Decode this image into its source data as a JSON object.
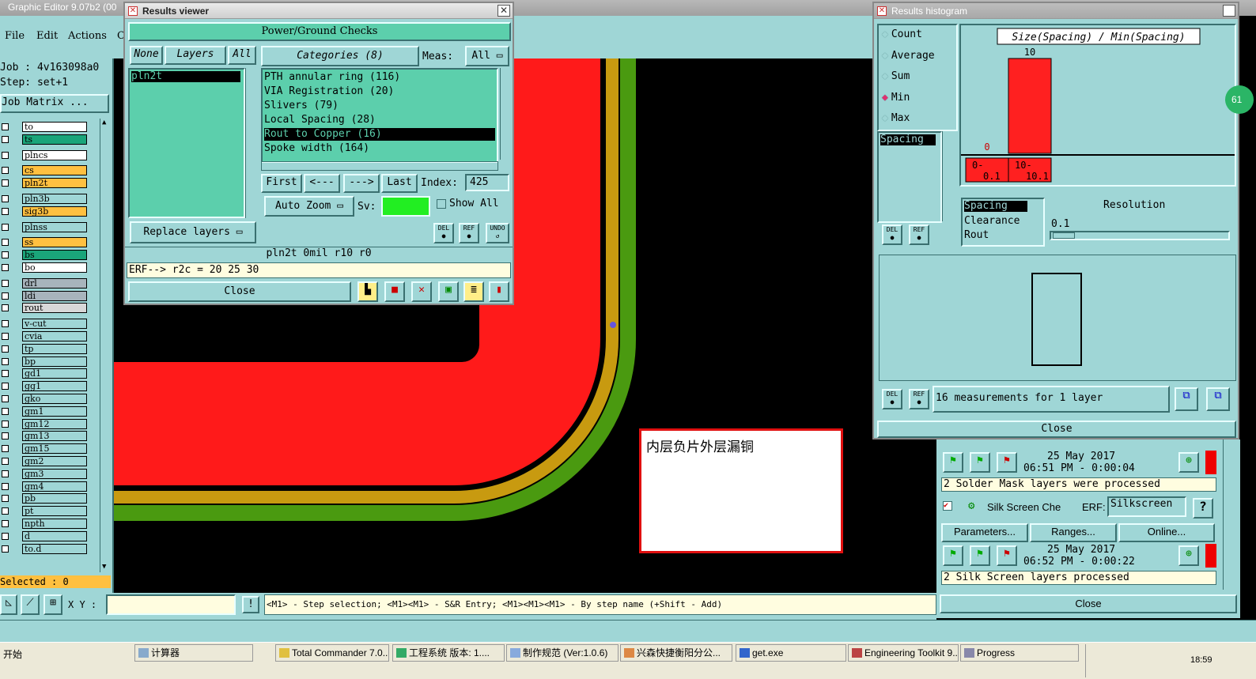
{
  "app": {
    "title": "Graphic Editor 9.07b2 (00",
    "menu": [
      "File",
      "Edit",
      "Actions",
      "C"
    ],
    "job": "Job : 4v163098a0",
    "step": "Step: set+1",
    "job_matrix": "Job Matrix ...",
    "selected": "Selected : 0",
    "xy_label": "X Y :",
    "status_hint": "<M1> - Step selection; <M1><M1> - S&R Entry; <M1><M1><M1> - By step name (+Shift - Add)"
  },
  "layers": [
    {
      "name": "to",
      "color": "#ffffff"
    },
    {
      "name": "ts",
      "color": "#1aa57a"
    },
    {
      "name": "plncs",
      "color": "#ffffff"
    },
    {
      "name": "cs",
      "color": "#ffc040"
    },
    {
      "name": "pln2t",
      "color": "#ffc040"
    },
    {
      "name": "pln3b",
      "color": "#9fd6d6"
    },
    {
      "name": "sig3b",
      "color": "#ffc040"
    },
    {
      "name": "plnss",
      "color": "#9fd6d6"
    },
    {
      "name": "ss",
      "color": "#ffc040"
    },
    {
      "name": "bs",
      "color": "#1aa57a"
    },
    {
      "name": "bo",
      "color": "#ffffff"
    },
    {
      "name": "drl",
      "color": "#a8b4bc"
    },
    {
      "name": "ldi",
      "color": "#a8b4bc"
    },
    {
      "name": "rout",
      "color": "#d8d8d8"
    },
    {
      "name": "v-cut",
      "color": "#9fd6d6"
    },
    {
      "name": "cvia",
      "color": "#9fd6d6"
    },
    {
      "name": "tp",
      "color": "#9fd6d6"
    },
    {
      "name": "bp",
      "color": "#9fd6d6"
    },
    {
      "name": "gd1",
      "color": "#9fd6d6"
    },
    {
      "name": "gg1",
      "color": "#9fd6d6"
    },
    {
      "name": "gko",
      "color": "#9fd6d6"
    },
    {
      "name": "gm1",
      "color": "#9fd6d6"
    },
    {
      "name": "gm12",
      "color": "#9fd6d6"
    },
    {
      "name": "gm13",
      "color": "#9fd6d6"
    },
    {
      "name": "gm15",
      "color": "#9fd6d6"
    },
    {
      "name": "gm2",
      "color": "#9fd6d6"
    },
    {
      "name": "gm3",
      "color": "#9fd6d6"
    },
    {
      "name": "gm4",
      "color": "#9fd6d6"
    },
    {
      "name": "pb",
      "color": "#9fd6d6"
    },
    {
      "name": "pt",
      "color": "#9fd6d6"
    },
    {
      "name": "npth",
      "color": "#9fd6d6"
    },
    {
      "name": "d",
      "color": "#9fd6d6"
    },
    {
      "name": "to.d",
      "color": "#9fd6d6"
    }
  ],
  "results_viewer": {
    "title": "Results viewer",
    "header": "Power/Ground Checks",
    "none": "None",
    "layers": "Layers",
    "all": "All",
    "layer_list": [
      "pln2t"
    ],
    "categories": "Categories (8)",
    "meas_label": "Meas:",
    "meas_value": "All",
    "category_list": [
      "PTH annular ring (116)",
      "VIA Registration (20)",
      "Slivers (79)",
      "Local Spacing (28)",
      "Rout to Copper (16)",
      "Spoke width (164)"
    ],
    "selected_category_index": 4,
    "first": "First",
    "prev": "<---",
    "next": "--->",
    "last": "Last",
    "index_label": "Index:",
    "index_value": "425",
    "auto_zoom": "Auto Zoom",
    "sv_label": "Sv:",
    "show_all": "Show All",
    "replace_layers": "Replace layers",
    "del": "DEL",
    "ref": "REF",
    "undo": "UNDO",
    "info_line": "pln2t 0mil r10 r0",
    "erf_line": "ERF--> r2c = 20 25 30",
    "close": "Close"
  },
  "histogram": {
    "title": "Results histogram",
    "modes": [
      "Count",
      "Average",
      "Sum",
      "Min",
      "Max"
    ],
    "selected_mode": "Min",
    "chart_title": "Size(Spacing) / Min(Spacing)",
    "bin_labels": [
      "0-\n0.1",
      "10-\n10.1"
    ],
    "type_list": [
      "Spacing"
    ],
    "del": "DEL",
    "ref": "REF",
    "kind_list": [
      "Spacing",
      "Clearance",
      "Rout"
    ],
    "resolution_label": "Resolution",
    "resolution_value": "0.1",
    "measurements": "16 measurements for 1 layer",
    "close": "Close"
  },
  "chart_data": {
    "type": "bar",
    "title": "Size(Spacing) / Min(Spacing)",
    "categories": [
      "0-0.1",
      "10-10.1"
    ],
    "values": [
      0,
      10
    ],
    "color": "#ff2020"
  },
  "checklist": {
    "date1": "25 May 2017",
    "time1": "06:51 PM - 0:00:04",
    "msg1": "2 Solder Mask layers were processed",
    "silk_name": "Silk Screen Che",
    "erf_label": "ERF:",
    "erf_value": "Silkscreen",
    "help": "?",
    "parameters": "Parameters...",
    "ranges": "Ranges...",
    "online": "Online...",
    "date2": "25 May 2017",
    "time2": "06:52 PM - 0:00:22",
    "msg2": "2 Silk Screen layers processed",
    "close": "Close",
    "badge": "61"
  },
  "annotation": "内层负片外层漏铜",
  "taskbar": {
    "start": "开始",
    "items": [
      "计算器",
      "Total Commander 7.0...",
      "工程系统  版本: 1....",
      "制作规范 (Ver:1.0.6)",
      "兴森快捷衡阳分公...",
      "get.exe",
      "Engineering Toolkit 9....",
      "Progress"
    ],
    "clock": "18:59"
  }
}
